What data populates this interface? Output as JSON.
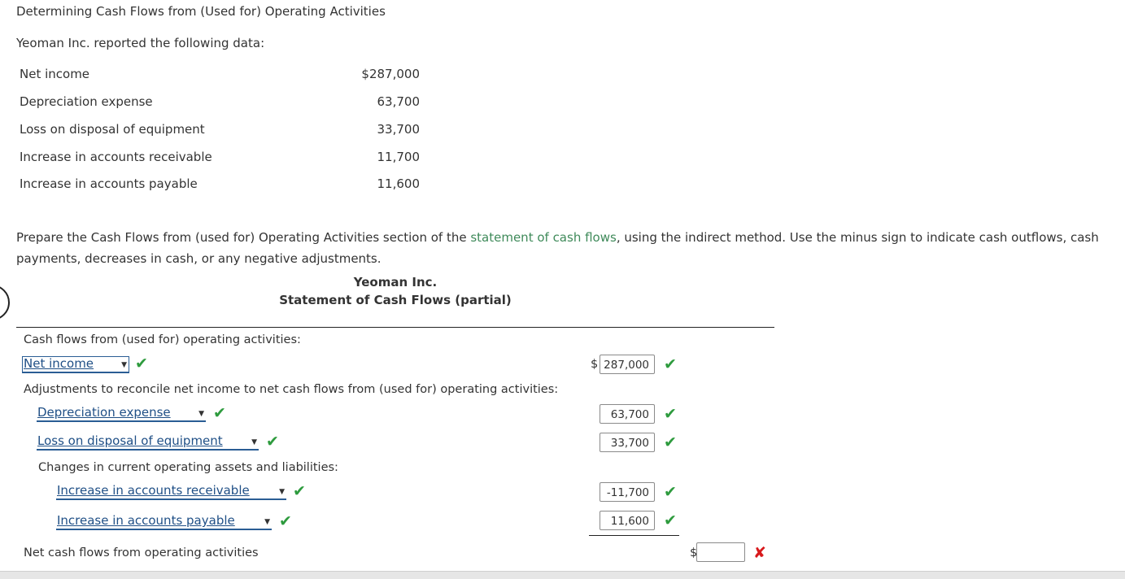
{
  "header": {
    "title": "Determining Cash Flows from (Used for) Operating Activities",
    "intro": "Yeoman Inc. reported the following data:"
  },
  "given_data": [
    {
      "label": "Net income",
      "value": "$287,000"
    },
    {
      "label": "Depreciation expense",
      "value": "63,700"
    },
    {
      "label": "Loss on disposal of equipment",
      "value": "33,700"
    },
    {
      "label": "Increase in accounts receivable",
      "value": "11,700"
    },
    {
      "label": "Increase in accounts payable",
      "value": "11,600"
    }
  ],
  "instructions": {
    "before_link": "Prepare the Cash Flows from (used for) Operating Activities section of the ",
    "link_text": "statement of cash flows",
    "after_link": ", using the indirect method. Use the minus sign to indicate cash outflows, cash payments, decreases in cash, or any negative adjustments."
  },
  "statement": {
    "company": "Yeoman Inc.",
    "title": "Statement of Cash Flows (partial)",
    "section_heading": "Cash flows from (used for) operating activities:",
    "adjustments_heading": "Adjustments to reconcile net income to net cash flows from (used for) operating activities:",
    "changes_heading": "Changes in current operating assets and liabilities:",
    "net_label": "Net cash flows from operating activities",
    "currency": "$",
    "rows": {
      "net_income": {
        "select": "Net income",
        "amount": "287,000"
      },
      "depreciation": {
        "select": "Depreciation expense",
        "amount": "63,700"
      },
      "loss_disposal": {
        "select": "Loss on disposal of equipment",
        "amount": "33,700"
      },
      "accounts_receivable": {
        "select": "Increase in accounts receivable",
        "amount": "-11,700"
      },
      "accounts_payable": {
        "select": "Increase in accounts payable",
        "amount": "11,600"
      }
    },
    "net_amount": ""
  },
  "marks": {
    "check": "✔",
    "cross": "✘"
  },
  "colors": {
    "correct": "#2e9b3e",
    "incorrect": "#d8191c",
    "link": "#3f8a5a",
    "select": "#1f4f86"
  }
}
